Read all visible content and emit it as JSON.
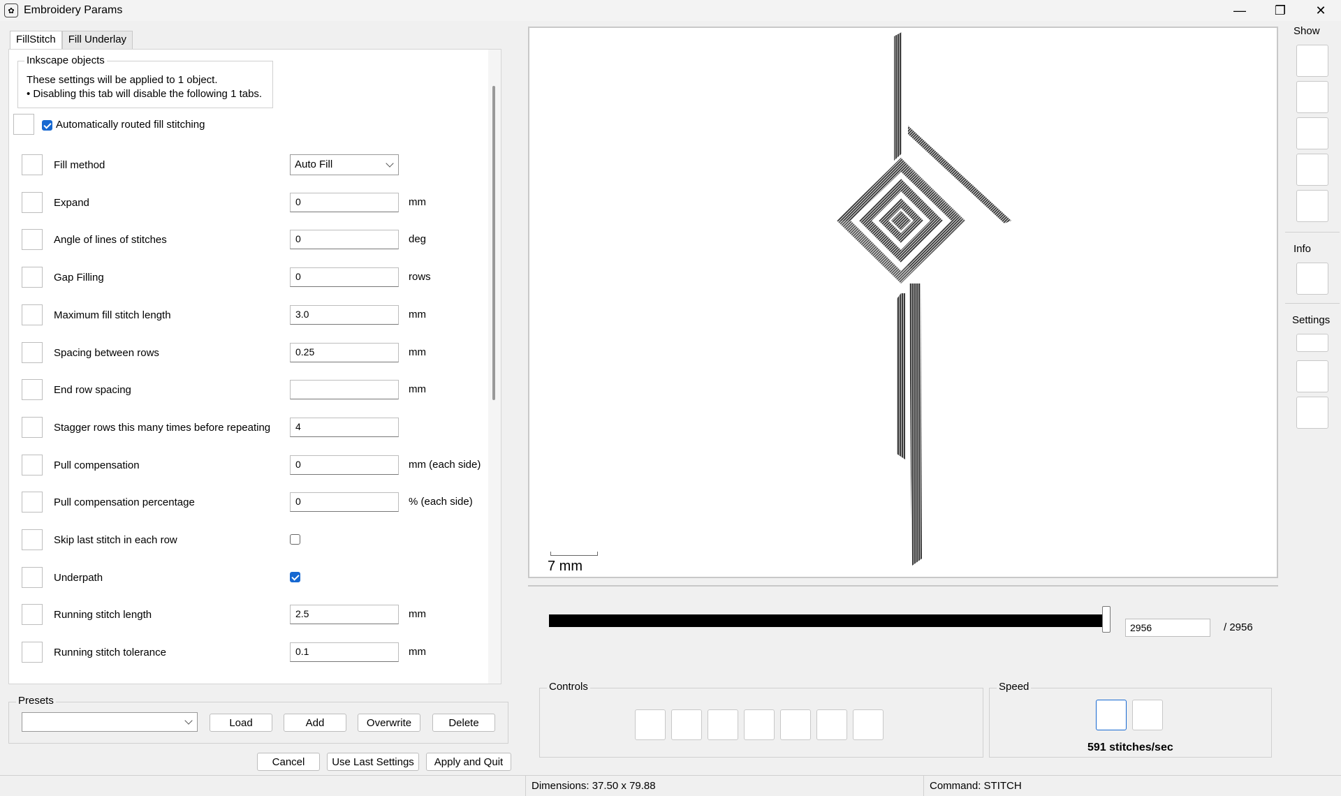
{
  "window": {
    "title": "Embroidery Params",
    "app_icon": "embroidery-icon"
  },
  "tabs": [
    "FillStitch",
    "Fill Underlay"
  ],
  "inkscape_objects": {
    "title": "Inkscape objects",
    "line1": "These settings will be applied to 1 object.",
    "line2": "• Disabling this tab will disable the following 1 tabs."
  },
  "auto_fill": {
    "label": "Automatically routed fill stitching",
    "checked": true
  },
  "params": [
    {
      "label": "Fill method",
      "type": "select",
      "value": "Auto Fill",
      "unit": ""
    },
    {
      "label": "Expand",
      "type": "text",
      "value": "0",
      "unit": "mm"
    },
    {
      "label": "Angle of lines of stitches",
      "type": "text",
      "value": "0",
      "unit": "deg"
    },
    {
      "label": "Gap Filling",
      "type": "text",
      "value": "0",
      "unit": "rows"
    },
    {
      "label": "Maximum fill stitch length",
      "type": "text",
      "value": "3.0",
      "unit": "mm"
    },
    {
      "label": "Spacing between rows",
      "type": "text",
      "value": "0.25",
      "unit": "mm"
    },
    {
      "label": "End row spacing",
      "type": "text",
      "value": "",
      "unit": "mm"
    },
    {
      "label": "Stagger rows this many times before repeating",
      "type": "text",
      "value": "4",
      "unit": ""
    },
    {
      "label": "Pull compensation",
      "type": "text",
      "value": "0",
      "unit": "mm (each side)"
    },
    {
      "label": "Pull compensation percentage",
      "type": "text",
      "value": "0",
      "unit": "% (each side)"
    },
    {
      "label": "Skip last stitch in each row",
      "type": "checkbox",
      "checked": false,
      "unit": ""
    },
    {
      "label": "Underpath",
      "type": "checkbox",
      "checked": true,
      "unit": ""
    },
    {
      "label": "Running stitch length",
      "type": "text",
      "value": "2.5",
      "unit": "mm"
    },
    {
      "label": "Running stitch tolerance",
      "type": "text",
      "value": "0.1",
      "unit": "mm"
    }
  ],
  "presets": {
    "title": "Presets",
    "selected": "",
    "load": "Load",
    "add": "Add",
    "overwrite": "Overwrite",
    "delete": "Delete"
  },
  "footer": {
    "cancel": "Cancel",
    "use_last": "Use Last Settings",
    "apply": "Apply and Quit"
  },
  "preview": {
    "scale_label": "7 mm",
    "current_stitch": "2956",
    "total_label": "/ 2956",
    "progress": 1.0,
    "controls_title": "Controls",
    "speed_title": "Speed",
    "speed_text": "591 stitches/sec"
  },
  "side": {
    "show": "Show",
    "info": "Info",
    "settings": "Settings"
  },
  "status": {
    "dimensions": "Dimensions: 37.50 x 79.88",
    "command": "Command: STITCH"
  }
}
